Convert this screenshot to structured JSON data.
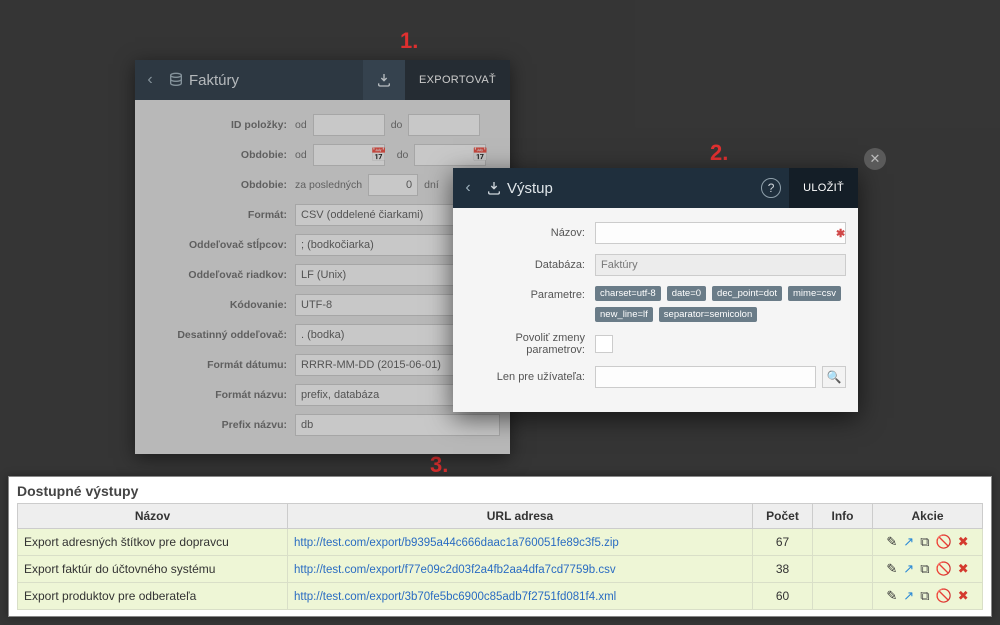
{
  "step_labels": {
    "one": "1.",
    "two": "2.",
    "three": "3."
  },
  "panel1": {
    "title": "Faktúry",
    "export_btn": "EXPORTOVAŤ",
    "fields": {
      "id_polozky": "ID položky:",
      "od": "od",
      "do": "do",
      "obdobie": "Obdobie:",
      "obdobie2": "Obdobie:",
      "za_poslednych": "za posledných",
      "za_poslednych_val": "0",
      "dni": "dní",
      "format": "Formát:",
      "format_val": "CSV (oddelené čiarkami)",
      "odd_stlpcov": "Oddeľovač stĺpcov:",
      "odd_stlpcov_val": "; (bodkočiarka)",
      "odd_riadkov": "Oddeľovač riadkov:",
      "odd_riadkov_val": "LF (Unix)",
      "kodovanie": "Kódovanie:",
      "kodovanie_val": "UTF-8",
      "des_odd": "Desatinný oddeľovač:",
      "des_odd_val": ". (bodka)",
      "format_datumu": "Formát dátumu:",
      "format_datumu_val": "RRRR-MM-DD (2015-06-01)",
      "format_nazvu": "Formát názvu:",
      "format_nazvu_val": "prefix, databáza",
      "prefix_nazvu": "Prefix názvu:",
      "prefix_nazvu_val": "db"
    }
  },
  "panel2": {
    "title": "Výstup",
    "save_btn": "ULOŽIŤ",
    "fields": {
      "nazov": "Názov:",
      "databaza": "Databáza:",
      "databaza_val": "Faktúry",
      "parametre": "Parametre:",
      "tags": [
        "charset=utf-8",
        "date=0",
        "dec_point=dot",
        "mime=csv",
        "new_line=lf",
        "separator=semicolon"
      ],
      "povolit": "Povoliť zmeny parametrov:",
      "len_pre": "Len pre užívateľa:"
    }
  },
  "panel3": {
    "heading": "Dostupné výstupy",
    "cols": {
      "nazov": "Názov",
      "url": "URL adresa",
      "pocet": "Počet",
      "info": "Info",
      "akcie": "Akcie"
    },
    "rows": [
      {
        "nazov": "Export adresných štítkov pre dopravcu",
        "url": "http://test.com/export/b9395a44c666daac1a760051fe89c3f5.zip",
        "pocet": "67"
      },
      {
        "nazov": "Export faktúr do účtovného systému",
        "url": "http://test.com/export/f77e09c2d03f2a4fb2aa4dfa7cd7759b.csv",
        "pocet": "38"
      },
      {
        "nazov": "Export produktov pre odberateľa",
        "url": "http://test.com/export/3b70fe5bc6900c85adb7f2751fd081f4.xml",
        "pocet": "60"
      }
    ]
  },
  "icons": {
    "edit": "✎",
    "open": "↗",
    "copy": "⧉",
    "block": "🚫",
    "del": "✖",
    "help": "?",
    "search": "🔍"
  }
}
